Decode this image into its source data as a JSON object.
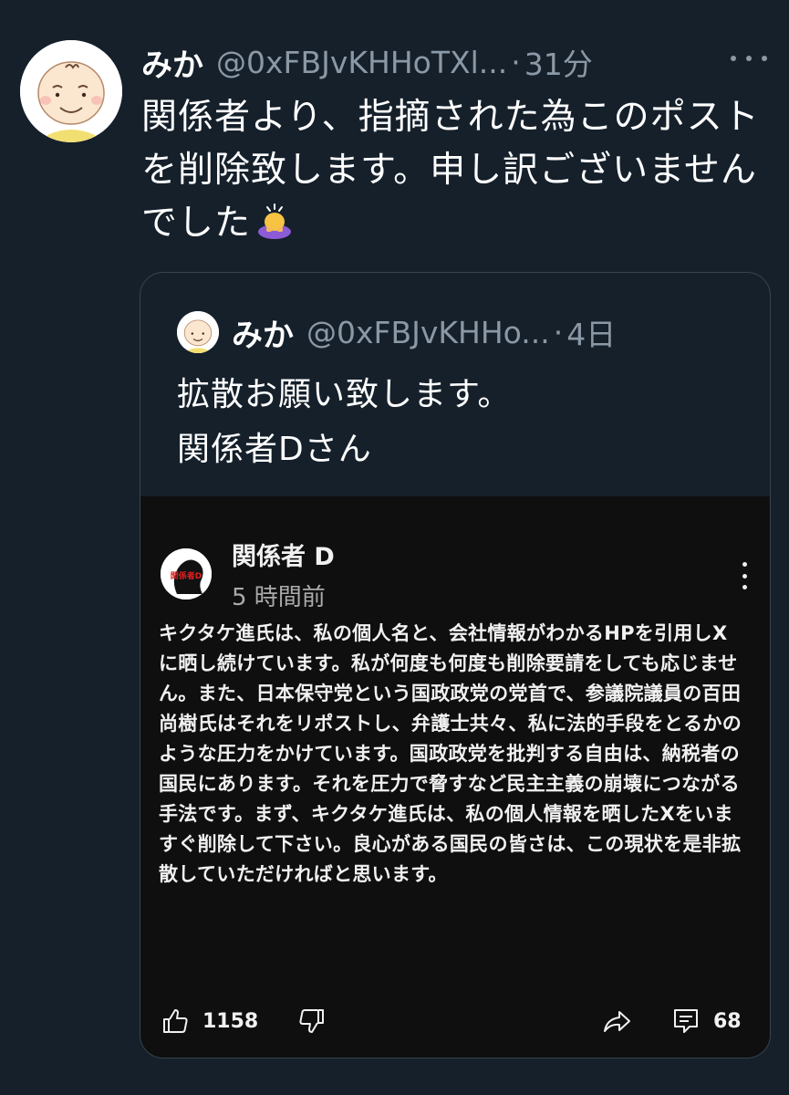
{
  "tweet": {
    "display_name": "みか",
    "handle": "@0xFBJvKHHoTXl...",
    "separator": "·",
    "time": "31分",
    "text": "関係者より、指摘された為このポストを削除致します。申し訳ございませんでした",
    "emoji_icon": "person-bowing-icon"
  },
  "quote": {
    "display_name": "みか",
    "handle": "@0xFBJvKHHo...",
    "separator": "·",
    "time": "4日",
    "line1": "拡散お願い致します。",
    "line2": "関係者Dさん"
  },
  "embed": {
    "channel_name": "関係者 D",
    "posted_time": "5 時間前",
    "avatar_text": "関係者D",
    "body": "キクタケ進氏は、私の個人名と、会社情報がわかるHPを引用しXに晒し続けています。私が何度も何度も削除要請をしても応じません。また、日本保守党という国政政党の党首で、参議院議員の百田尚樹氏はそれをリポストし、弁護士共々、私に法的手段をとるかのような圧力をかけています。国政政党を批判する自由は、納税者の国民にあります。それを圧力で脅すなど民主主義の崩壊につながる手法です。まず、キクタケ進氏は、私の個人情報を晒したXをいますぐ削除して下さい。良心がある国民の皆さは、この現状を是非拡散していただければと思います。",
    "like_count": "1158",
    "comment_count": "68"
  },
  "colors": {
    "background": "#15202b",
    "secondary_text": "#8b98a5",
    "border": "#38444d",
    "embed_background": "#0f0f0f"
  }
}
